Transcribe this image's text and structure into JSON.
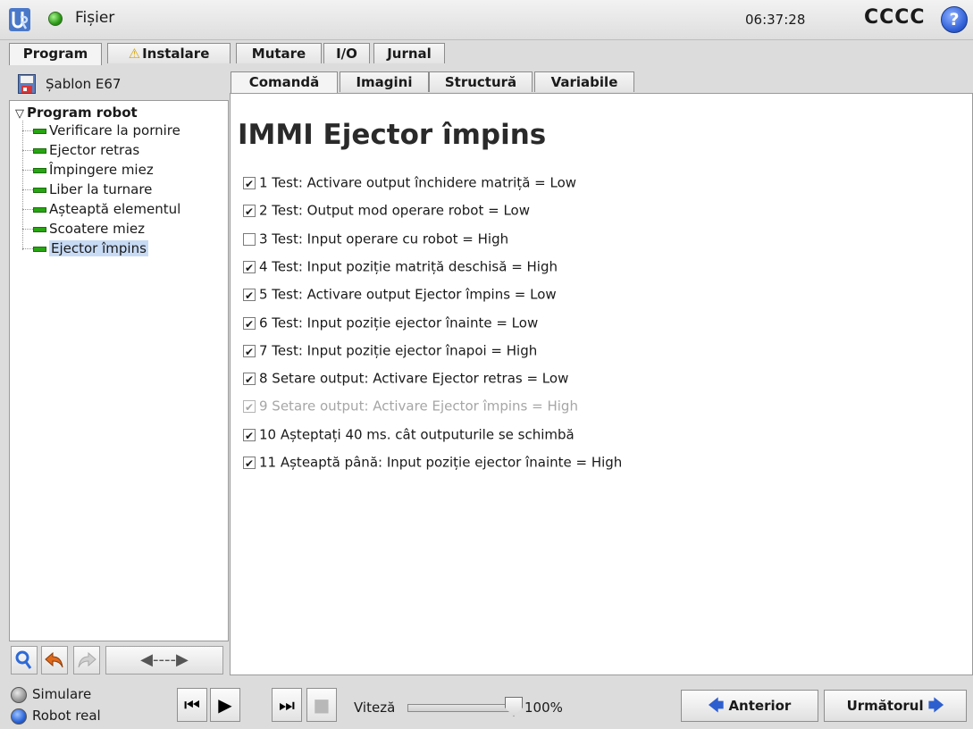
{
  "header": {
    "file_menu": "Fișier",
    "time": "06:37:28",
    "robot_name": "CCCC",
    "help_label": "?"
  },
  "main_tabs": [
    {
      "label": "Program",
      "active": true
    },
    {
      "label": "Instalare",
      "warning_icon": "warning-triangle-icon"
    },
    {
      "label": "Mutare"
    },
    {
      "label": "I/O"
    },
    {
      "label": "Jurnal"
    }
  ],
  "left_panel": {
    "template_name": "Șablon E67",
    "tree": {
      "root": "Program robot",
      "items": [
        {
          "label": "Verificare la pornire"
        },
        {
          "label": "Ejector retras"
        },
        {
          "label": "Împingere miez"
        },
        {
          "label": "Liber la turnare"
        },
        {
          "label": "Așteaptă elementul"
        },
        {
          "label": "Scoatere miez"
        },
        {
          "label": "Ejector împins",
          "selected": true
        }
      ]
    },
    "tools": {
      "wide_label": "◀----▶"
    }
  },
  "sub_tabs": [
    {
      "label": "Comandă",
      "active": true
    },
    {
      "label": "Imagini"
    },
    {
      "label": "Structură"
    },
    {
      "label": "Variabile"
    }
  ],
  "command": {
    "title": "IMMI Ejector împins",
    "rows": [
      {
        "checked": true,
        "text": "1 Test: Activare output închidere matriță = Low"
      },
      {
        "checked": true,
        "text": "2 Test: Output mod operare robot = Low"
      },
      {
        "checked": false,
        "text": "3 Test: Input operare cu robot = High"
      },
      {
        "checked": true,
        "text": "4 Test: Input poziție matriță deschisă = High"
      },
      {
        "checked": true,
        "text": "5 Test: Activare output Ejector împins = Low"
      },
      {
        "checked": true,
        "text": "6 Test: Input poziție ejector înainte = Low"
      },
      {
        "checked": true,
        "text": "7 Test: Input poziție ejector înapoi = High"
      },
      {
        "checked": true,
        "text": "8 Setare output: Activare Ejector retras = Low"
      },
      {
        "checked": true,
        "disabled": true,
        "text": "9 Setare output: Activare Ejector împins = High"
      },
      {
        "checked": true,
        "text": "10 Așteptați 40 ms. cât outputurile se schimbă"
      },
      {
        "checked": true,
        "text": "11 Așteaptă până: Input poziție ejector înainte = High"
      }
    ]
  },
  "footer": {
    "mode_simulation": "Simulare",
    "mode_real": "Robot real",
    "speed_label": "Viteză",
    "speed_value": "100%",
    "speed_fraction": 1.0,
    "prev_label": "Anterior",
    "next_label": "Următorul"
  },
  "colors": {
    "accent": "#2e5fcf",
    "status_ok": "#2c9a18",
    "tree_bar": "#27a512",
    "selection": "#c8dbf5"
  }
}
